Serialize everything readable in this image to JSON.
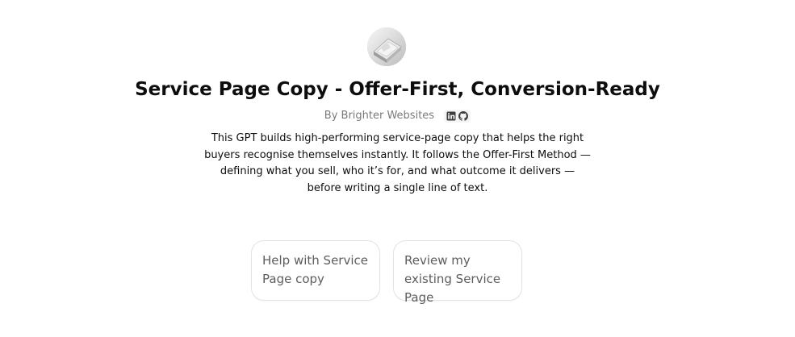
{
  "gpt": {
    "title": "Service Page Copy - Offer-First, Conversion-Ready",
    "byline": "By Brighter Websites",
    "description": "This GPT builds high-performing service-page copy that helps the right buyers recognise themselves instantly. It follows the Offer-First Method — defining what you sell, who it’s for, and what outcome it delivers — before writing a single line of text.",
    "avatar_icon": "gpt-avatar-image",
    "social_icons": [
      "linkedin-icon",
      "github-icon"
    ]
  },
  "conversation_starters": [
    {
      "label": "Help with Service Page copy"
    },
    {
      "label": "Review my existing Service Page"
    }
  ]
}
